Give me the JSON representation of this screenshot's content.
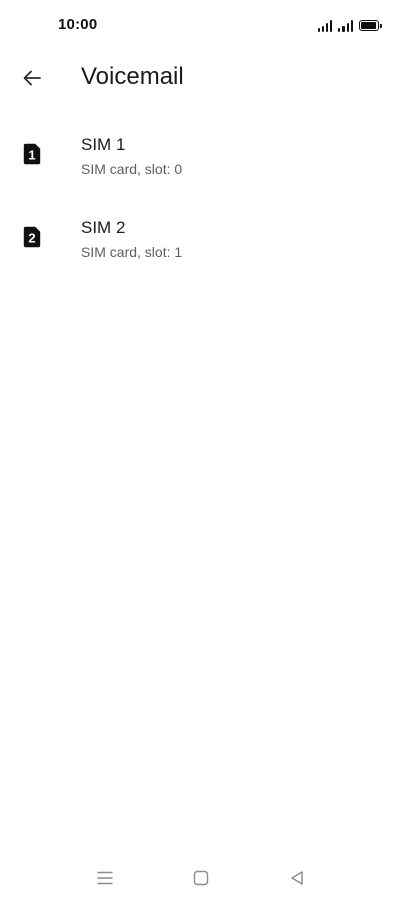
{
  "status_bar": {
    "time": "10:00",
    "icons": [
      "signal-sim1-icon",
      "signal-sim2-icon",
      "battery-icon"
    ],
    "battery_level": 1.0
  },
  "app_bar": {
    "back_icon": "arrow-left-icon",
    "title": "Voicemail"
  },
  "sims": [
    {
      "icon": "sim-card-1-icon",
      "badge": "1",
      "title": "SIM 1",
      "subtitle": "SIM card, slot: 0"
    },
    {
      "icon": "sim-card-2-icon",
      "badge": "2",
      "title": "SIM 2",
      "subtitle": "SIM card, slot: 1"
    }
  ],
  "nav_bar": {
    "icons": [
      "menu-lines-icon",
      "home-square-icon",
      "back-triangle-icon"
    ]
  },
  "colors": {
    "background": "#ffffff",
    "text_primary": "#1b1b1b",
    "text_secondary": "#5f5f5f"
  }
}
